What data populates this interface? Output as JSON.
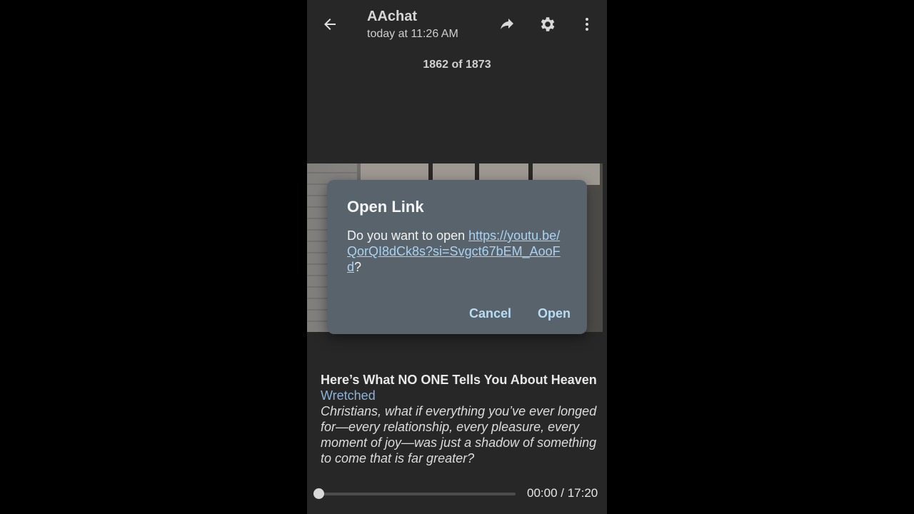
{
  "header": {
    "title": "AAchat",
    "subtitle": "today at 11:26 AM",
    "back_icon": "back-arrow-icon",
    "share_icon": "share-icon",
    "settings_icon": "gear-icon",
    "more_icon": "more-vert-icon"
  },
  "counter": "1862 of 1873",
  "dialog": {
    "title": "Open Link",
    "prefix": "Do you want to open ",
    "url": "https://youtu.be/QorQI8dCk8s?si=Svgct67bEM_AooFd",
    "suffix": "?",
    "cancel_label": "Cancel",
    "open_label": "Open"
  },
  "video": {
    "title": "Here’s What NO ONE Tells You About Heaven",
    "channel": "Wretched",
    "description": "Christians, what if everything you’ve ever longed for—every relationship, every pleasure, every moment of joy—was just a shadow of something to come that is far greater?"
  },
  "player": {
    "time": "00:00 / 17:20",
    "progress_fraction": 0
  },
  "colors": {
    "background": "#272727",
    "dialog": "#59636b",
    "accent": "#b7dcf5",
    "link": "#a9d3f0",
    "channel": "#8ab4d9"
  }
}
